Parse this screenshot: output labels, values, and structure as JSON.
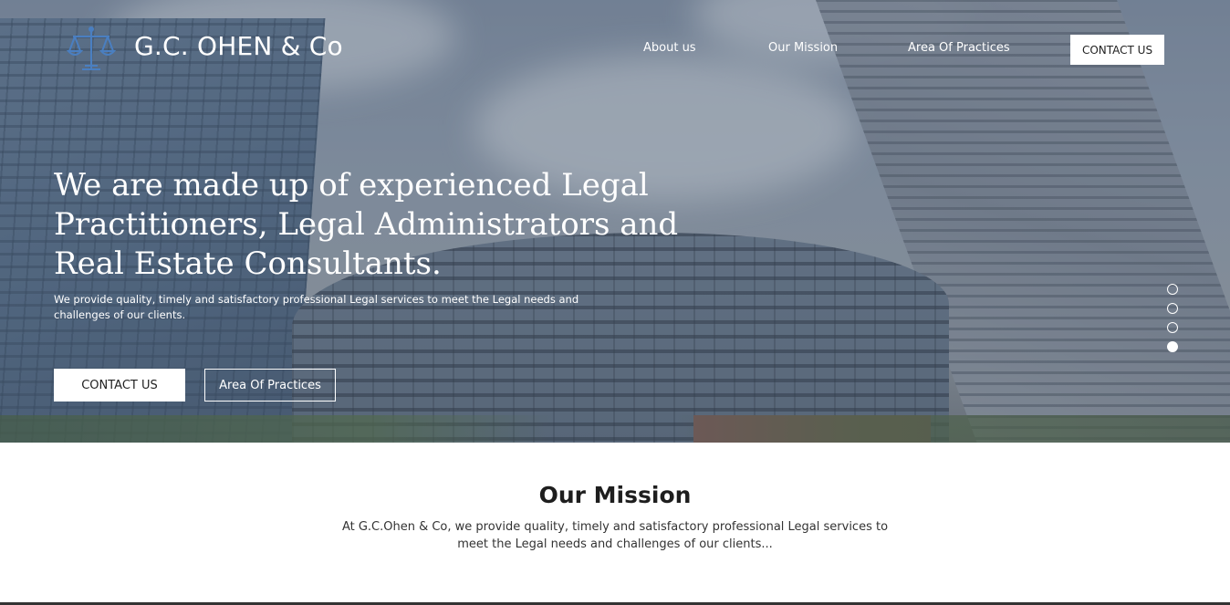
{
  "brand": {
    "name": "G.C. OHEN & Co",
    "logo_icon": "scales-of-justice-icon",
    "accent": "#4a7fc1"
  },
  "nav": {
    "links": [
      {
        "label": "About us"
      },
      {
        "label": "Our Mission"
      },
      {
        "label": "Area Of Practices"
      }
    ],
    "cta_label": "CONTACT US"
  },
  "hero": {
    "title": "We are made up of experienced Legal Practitioners, Legal Administrators and Real Estate Consultants.",
    "subtitle": "We provide quality, timely and satisfactory professional Legal services to meet the Legal needs and challenges of our clients.",
    "primary_button": "CONTACT US",
    "secondary_button": "Area Of Practices",
    "slides_total": 4,
    "active_slide": 4
  },
  "mission": {
    "title": "Our Mission",
    "text": "At G.C.Ohen & Co, we provide quality, timely and satisfactory professional Legal services to meet the Legal needs and challenges of our clients..."
  }
}
